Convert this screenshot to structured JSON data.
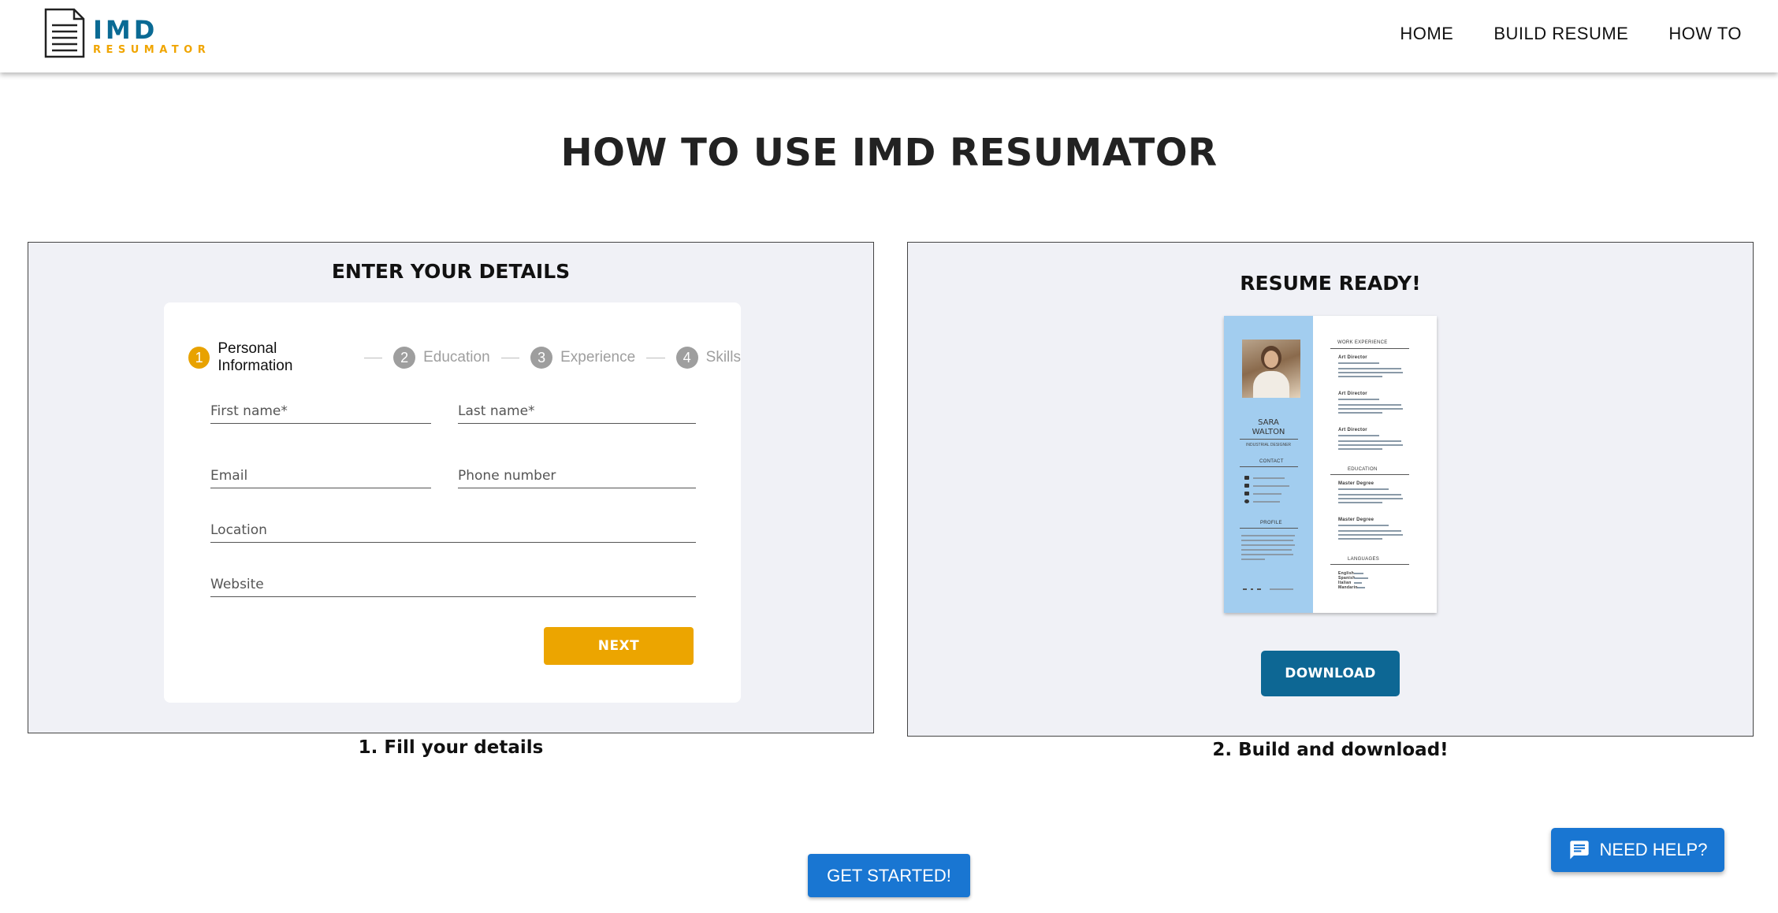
{
  "header": {
    "logo_main": "IMD",
    "logo_sub": "RESUMATOR",
    "nav": [
      {
        "label": "HOME"
      },
      {
        "label": "BUILD RESUME"
      },
      {
        "label": "HOW TO"
      }
    ]
  },
  "page_title": "HOW TO USE IMD RESUMATOR",
  "left_panel": {
    "heading": "ENTER YOUR DETAILS",
    "caption": "1. Fill your details",
    "steps": [
      {
        "num": "1",
        "label": "Personal Information"
      },
      {
        "num": "2",
        "label": "Education"
      },
      {
        "num": "3",
        "label": "Experience"
      },
      {
        "num": "4",
        "label": "Skills"
      }
    ],
    "active_step": 1,
    "fields": {
      "first_name": "First name*",
      "last_name": "Last name*",
      "email": "Email",
      "phone": "Phone number",
      "location": "Location",
      "website": "Website"
    },
    "next_label": "NEXT"
  },
  "right_panel": {
    "heading": "RESUME READY!",
    "caption": "2. Build and download!",
    "resume": {
      "name": "SARA\nWALTON",
      "title": "INDUSTRIAL DESIGNER",
      "contact_head": "CONTACT",
      "profile_head": "PROFILE",
      "work_head": "WORK EXPERIENCE",
      "education_head": "EDUCATION",
      "languages_head": "LANGUAGES",
      "job_title": "Art Director",
      "degree": "Master Degree",
      "languages": [
        "English",
        "Spanish",
        "Italian",
        "Mandarin"
      ]
    },
    "download_label": "DOWNLOAD"
  },
  "get_started_label": "GET STARTED!",
  "help_label": "NEED HELP?",
  "colors": {
    "brand_blue": "#0a6a94",
    "brand_orange": "#f0a500",
    "button_blue": "#1976d2",
    "panel_bg": "#f0f1f6",
    "resume_sidebar": "#a2cdef"
  }
}
